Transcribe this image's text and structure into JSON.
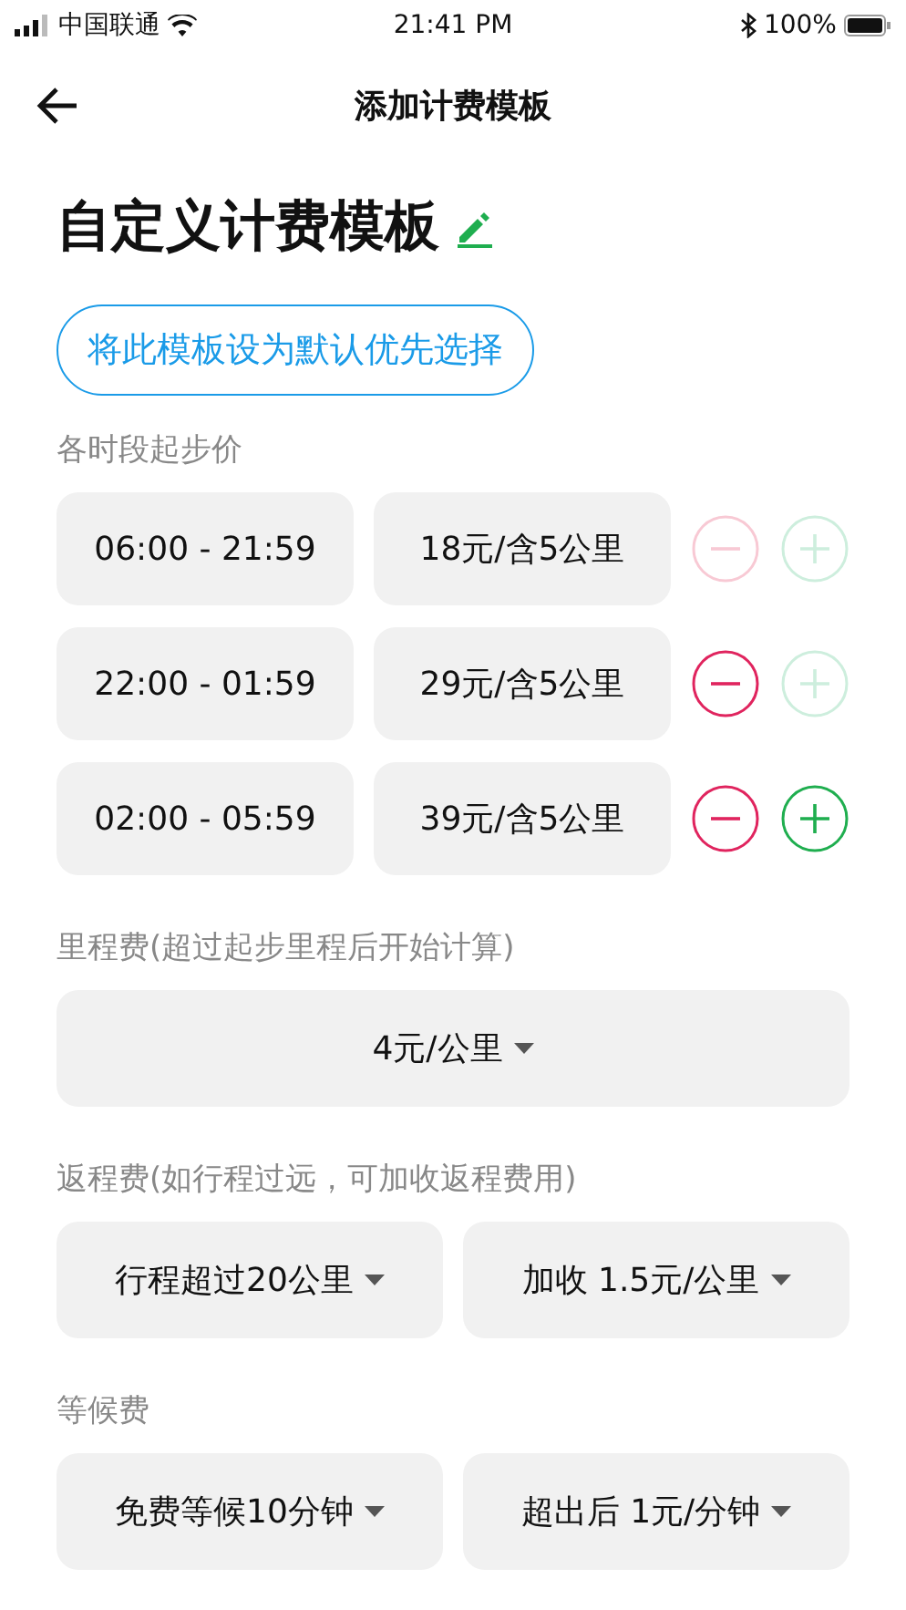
{
  "status_bar": {
    "carrier": "中国联通",
    "time": "21:41 PM",
    "battery": "100%"
  },
  "nav": {
    "title": "添加计费模板"
  },
  "template": {
    "name": "自定义计费模板",
    "default_button": "将此模板设为默认优先选择"
  },
  "start_price": {
    "label": "各时段起步价",
    "rows": [
      {
        "time": "06:00 - 21:59",
        "price": "18元/含5公里",
        "remove_disabled": true,
        "add_disabled": true
      },
      {
        "time": "22:00 - 01:59",
        "price": "29元/含5公里",
        "remove_disabled": false,
        "add_disabled": true
      },
      {
        "time": "02:00 - 05:59",
        "price": "39元/含5公里",
        "remove_disabled": false,
        "add_disabled": false
      }
    ]
  },
  "mileage": {
    "label": "里程费(超过起步里程后开始计算)",
    "options": [
      "4元/公里"
    ]
  },
  "return_fee": {
    "label": "返程费(如行程过远，可加收返程费用)",
    "options": [
      "行程超过20公里",
      "加收 1.5元/公里"
    ]
  },
  "waiting_fee": {
    "label": "等候费",
    "options": [
      "免费等候10分钟",
      "超出后 1元/分钟"
    ]
  }
}
